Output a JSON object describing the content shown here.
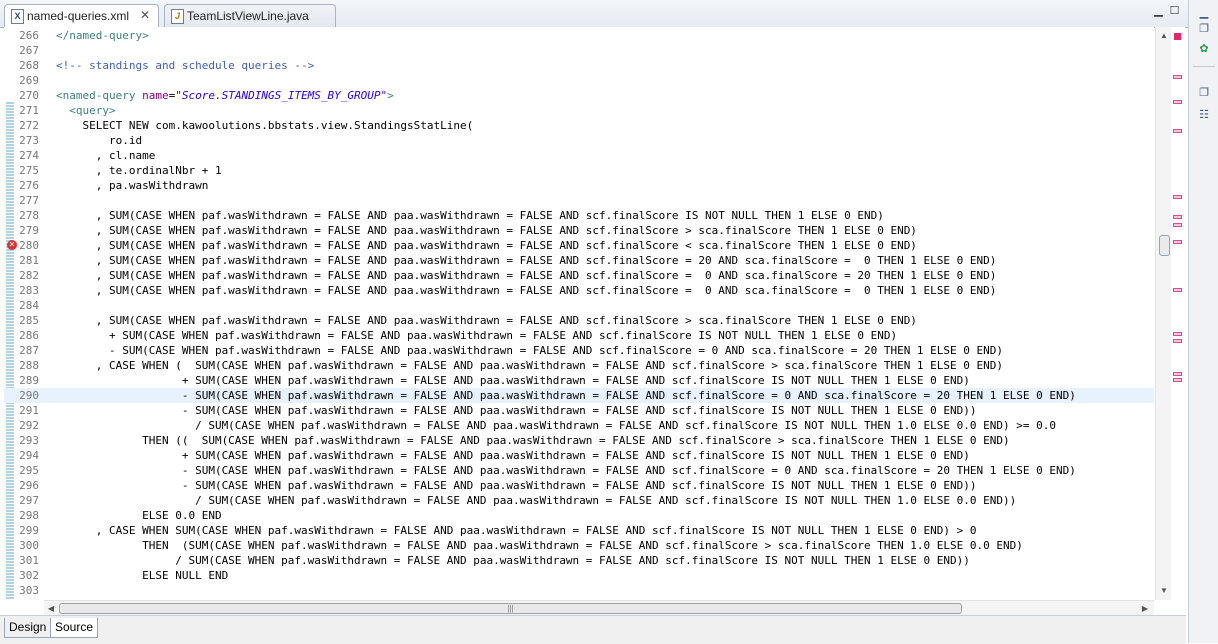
{
  "tabs": [
    {
      "label": "named-queries.xml",
      "icon": "xml-file-icon",
      "active": true
    },
    {
      "label": "TeamListViewLine.java",
      "icon": "java-file-icon",
      "active": false
    }
  ],
  "bottom_tabs": [
    "Design",
    "Source"
  ],
  "selected_bottom_tab": "Source",
  "highlighted_line": "290",
  "error_line": "280",
  "lines": [
    {
      "n": "266",
      "t": "</named-query>"
    },
    {
      "n": "267",
      "t": ""
    },
    {
      "n": "268",
      "t": "<!-- standings and schedule queries -->"
    },
    {
      "n": "269",
      "t": ""
    },
    {
      "n": "270",
      "t": "<named-query name=\"Score.STANDINGS_ITEMS_BY_GROUP\">"
    },
    {
      "n": "271",
      "t": "  <query>"
    },
    {
      "n": "272",
      "t": "    SELECT NEW com.kawoolutions.bbstats.view.StandingsStatLine("
    },
    {
      "n": "273",
      "t": "        ro.id"
    },
    {
      "n": "274",
      "t": "      , cl.name"
    },
    {
      "n": "275",
      "t": "      , te.ordinalNbr + 1"
    },
    {
      "n": "276",
      "t": "      , pa.wasWithdrawn"
    },
    {
      "n": "277",
      "t": ""
    },
    {
      "n": "278",
      "t": "      , SUM(CASE WHEN paf.wasWithdrawn = FALSE AND paa.wasWithdrawn = FALSE AND scf.finalScore IS NOT NULL THEN 1 ELSE 0 END)"
    },
    {
      "n": "279",
      "t": "      , SUM(CASE WHEN paf.wasWithdrawn = FALSE AND paa.wasWithdrawn = FALSE AND scf.finalScore > sca.finalScore THEN 1 ELSE 0 END)"
    },
    {
      "n": "280",
      "t": "      , SUM(CASE WHEN paf.wasWithdrawn = FALSE AND paa.wasWithdrawn = FALSE AND scf.finalScore < sca.finalScore THEN 1 ELSE 0 END)"
    },
    {
      "n": "281",
      "t": "      , SUM(CASE WHEN paf.wasWithdrawn = FALSE AND paa.wasWithdrawn = FALSE AND scf.finalScore = 20 AND sca.finalScore =  0 THEN 1 ELSE 0 END)"
    },
    {
      "n": "282",
      "t": "      , SUM(CASE WHEN paf.wasWithdrawn = FALSE AND paa.wasWithdrawn = FALSE AND scf.finalScore =  0 AND sca.finalScore = 20 THEN 1 ELSE 0 END)"
    },
    {
      "n": "283",
      "t": "      , SUM(CASE WHEN paf.wasWithdrawn = FALSE AND paa.wasWithdrawn = FALSE AND scf.finalScore =  0 AND sca.finalScore =  0 THEN 1 ELSE 0 END)"
    },
    {
      "n": "284",
      "t": ""
    },
    {
      "n": "285",
      "t": "      , SUM(CASE WHEN paf.wasWithdrawn = FALSE AND paa.wasWithdrawn = FALSE AND scf.finalScore > sca.finalScore THEN 1 ELSE 0 END)"
    },
    {
      "n": "286",
      "t": "        + SUM(CASE WHEN paf.wasWithdrawn = FALSE AND paa.wasWithdrawn = FALSE AND scf.finalScore IS NOT NULL THEN 1 ELSE 0 END)"
    },
    {
      "n": "287",
      "t": "        - SUM(CASE WHEN paf.wasWithdrawn = FALSE AND paa.wasWithdrawn = FALSE AND scf.finalScore = 0 AND sca.finalScore = 20 THEN 1 ELSE 0 END)"
    },
    {
      "n": "288",
      "t": "      , CASE WHEN (  SUM(CASE WHEN paf.wasWithdrawn = FALSE AND paa.wasWithdrawn = FALSE AND scf.finalScore > sca.finalScore THEN 1 ELSE 0 END)"
    },
    {
      "n": "289",
      "t": "                   + SUM(CASE WHEN paf.wasWithdrawn = FALSE AND paa.wasWithdrawn = FALSE AND scf.finalScore IS NOT NULL THEN 1 ELSE 0 END)"
    },
    {
      "n": "290",
      "t": "                   - SUM(CASE WHEN paf.wasWithdrawn = FALSE AND paa.wasWithdrawn = FALSE AND scf.finalScore = 0 AND sca.finalScore = 20 THEN 1 ELSE 0 END)"
    },
    {
      "n": "291",
      "t": "                   - SUM(CASE WHEN paf.wasWithdrawn = FALSE AND paa.wasWithdrawn = FALSE AND scf.finalScore IS NOT NULL THEN 1 ELSE 0 END))"
    },
    {
      "n": "292",
      "t": "                     / SUM(CASE WHEN paf.wasWithdrawn = FALSE AND paa.wasWithdrawn = FALSE AND scf.finalScore IS NOT NULL THEN 1.0 ELSE 0.0 END) >= 0.0"
    },
    {
      "n": "293",
      "t": "             THEN ((  SUM(CASE WHEN paf.wasWithdrawn = FALSE AND paa.wasWithdrawn = FALSE AND scf.finalScore > sca.finalScore THEN 1 ELSE 0 END)"
    },
    {
      "n": "294",
      "t": "                   + SUM(CASE WHEN paf.wasWithdrawn = FALSE AND paa.wasWithdrawn = FALSE AND scf.finalScore IS NOT NULL THEN 1 ELSE 0 END)"
    },
    {
      "n": "295",
      "t": "                   - SUM(CASE WHEN paf.wasWithdrawn = FALSE AND paa.wasWithdrawn = FALSE AND scf.finalScore = 0 AND sca.finalScore = 20 THEN 1 ELSE 0 END)"
    },
    {
      "n": "296",
      "t": "                   - SUM(CASE WHEN paf.wasWithdrawn = FALSE AND paa.wasWithdrawn = FALSE AND scf.finalScore IS NOT NULL THEN 1 ELSE 0 END))"
    },
    {
      "n": "297",
      "t": "                     / SUM(CASE WHEN paf.wasWithdrawn = FALSE AND paa.wasWithdrawn = FALSE AND scf.finalScore IS NOT NULL THEN 1.0 ELSE 0.0 END))"
    },
    {
      "n": "298",
      "t": "             ELSE 0.0 END"
    },
    {
      "n": "299",
      "t": "      , CASE WHEN SUM(CASE WHEN paf.wasWithdrawn = FALSE AND paa.wasWithdrawn = FALSE AND scf.finalScore IS NOT NULL THEN 1 ELSE 0 END) > 0"
    },
    {
      "n": "300",
      "t": "             THEN  (SUM(CASE WHEN paf.wasWithdrawn = FALSE AND paa.wasWithdrawn = FALSE AND scf.finalScore > sca.finalScore THEN 1.0 ELSE 0.0 END)"
    },
    {
      "n": "301",
      "t": "                  / SUM(CASE WHEN paf.wasWithdrawn = FALSE AND paa.wasWithdrawn = FALSE AND scf.finalScore IS NOT NULL THEN 1 ELSE 0 END))"
    },
    {
      "n": "302",
      "t": "             ELSE NULL END"
    },
    {
      "n": "303",
      "t": ""
    }
  ]
}
